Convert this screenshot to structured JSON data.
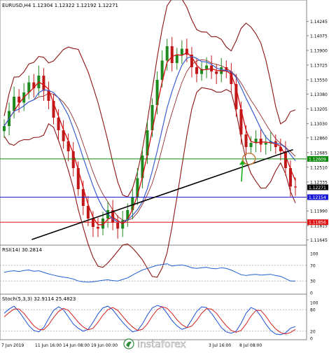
{
  "chart_data": [
    {
      "type": "candlestick",
      "title": "EURUSD,H4  1.12304 1.12322 1.12192 1.12271",
      "yaxis_labels": [
        "1.14245",
        "1.14075",
        "1.13900",
        "1.13725",
        "1.13550",
        "1.13380",
        "1.13205",
        "1.13030",
        "1.12860",
        "1.12685",
        "1.12510",
        "1.12335",
        "1.11990",
        "1.11815",
        "1.11645"
      ],
      "ylim": [
        1.116,
        1.144
      ],
      "price_badges": [
        {
          "text": "1.12609",
          "value": 1.12609,
          "color": "#0a8a0a"
        },
        {
          "text": "1.12271",
          "value": 1.12271,
          "color": "#000000"
        },
        {
          "text": "1.12154",
          "value": 1.12154,
          "color": "#1a1ad6"
        },
        {
          "text": "1.11856",
          "value": 1.11856,
          "color": "#e01010"
        }
      ],
      "horizontal_lines": [
        {
          "value": 1.12609,
          "color": "#0a8a0a"
        },
        {
          "value": 1.12154,
          "color": "#1a1ad6"
        },
        {
          "value": 1.11856,
          "color": "#e01010"
        }
      ],
      "trendline": {
        "from": [
          0.1,
          1.1165
        ],
        "to": [
          0.96,
          1.1272
        ],
        "color": "#000000"
      },
      "close_series": [
        1.13,
        1.1318,
        1.1335,
        1.1328,
        1.134,
        1.1352,
        1.1345,
        1.136,
        1.1342,
        1.133,
        1.131,
        1.1295,
        1.1282,
        1.127,
        1.125,
        1.1225,
        1.1205,
        1.119,
        1.118,
        1.1178,
        1.119,
        1.12,
        1.1185,
        1.1178,
        1.1188,
        1.12,
        1.1215,
        1.1238,
        1.1265,
        1.1295,
        1.1325,
        1.1355,
        1.1378,
        1.1395,
        1.1375,
        1.1385,
        1.1392,
        1.1385,
        1.137,
        1.1362,
        1.1368,
        1.1372,
        1.1365,
        1.1362,
        1.137,
        1.1365,
        1.135,
        1.132,
        1.129,
        1.1275,
        1.128,
        1.1285,
        1.1278,
        1.128,
        1.1282,
        1.1275,
        1.127,
        1.125,
        1.1228,
        1.1227
      ],
      "annotations": [
        "green-arrow-up",
        "orange-ellipse"
      ]
    },
    {
      "type": "line",
      "title": "RSI(14) 30.2814",
      "yaxis_labels": [
        "100",
        "70",
        "30",
        "0"
      ],
      "ylim": [
        0,
        100
      ],
      "levels": [
        70,
        30
      ],
      "values": [
        52,
        55,
        56,
        54,
        57,
        58,
        55,
        56,
        52,
        48,
        45,
        42,
        40,
        38,
        35,
        30,
        28,
        27,
        28,
        30,
        32,
        33,
        31,
        30,
        34,
        38,
        45,
        52,
        58,
        62,
        66,
        70,
        72,
        74,
        68,
        70,
        71,
        68,
        64,
        62,
        64,
        65,
        62,
        61,
        64,
        62,
        58,
        52,
        46,
        44,
        46,
        47,
        45,
        46,
        47,
        44,
        42,
        36,
        30,
        30
      ]
    },
    {
      "type": "line",
      "title": "Stoch(5,3,3) 32.9114 25.4823",
      "yaxis_labels": [
        "100",
        "80",
        "20",
        "0"
      ],
      "ylim": [
        0,
        100
      ],
      "levels": [
        80,
        20
      ],
      "series": [
        {
          "color": "#1a4fd6",
          "values": [
            70,
            82,
            90,
            75,
            55,
            35,
            22,
            18,
            30,
            55,
            78,
            88,
            80,
            60,
            40,
            28,
            20,
            25,
            45,
            68,
            85,
            90,
            80,
            62,
            45,
            30,
            18,
            22,
            40,
            65,
            85,
            92,
            88,
            70,
            50,
            35,
            25,
            30,
            52,
            75,
            88,
            86,
            70,
            50,
            30,
            18,
            14,
            20,
            42,
            70,
            86,
            80,
            62,
            40,
            22,
            12,
            10,
            15,
            28,
            33
          ]
        },
        {
          "color": "#d62020",
          "values": [
            60,
            72,
            82,
            82,
            70,
            52,
            35,
            25,
            24,
            38,
            58,
            75,
            84,
            78,
            62,
            45,
            32,
            24,
            28,
            45,
            65,
            80,
            86,
            78,
            62,
            45,
            32,
            22,
            25,
            40,
            62,
            80,
            88,
            84,
            70,
            52,
            38,
            30,
            34,
            50,
            70,
            83,
            82,
            70,
            52,
            35,
            22,
            17,
            22,
            40,
            62,
            78,
            78,
            62,
            42,
            26,
            16,
            12,
            16,
            25
          ]
        }
      ]
    }
  ],
  "x_axis": {
    "labels": [
      "7 Jun 2019",
      "11 Jun 16:00",
      "14 Jun 08:00",
      "19 Jun 00:00",
      "3 Jul 16:00",
      "8 Jul 08:00"
    ]
  },
  "watermark": {
    "text": "instaforex"
  }
}
